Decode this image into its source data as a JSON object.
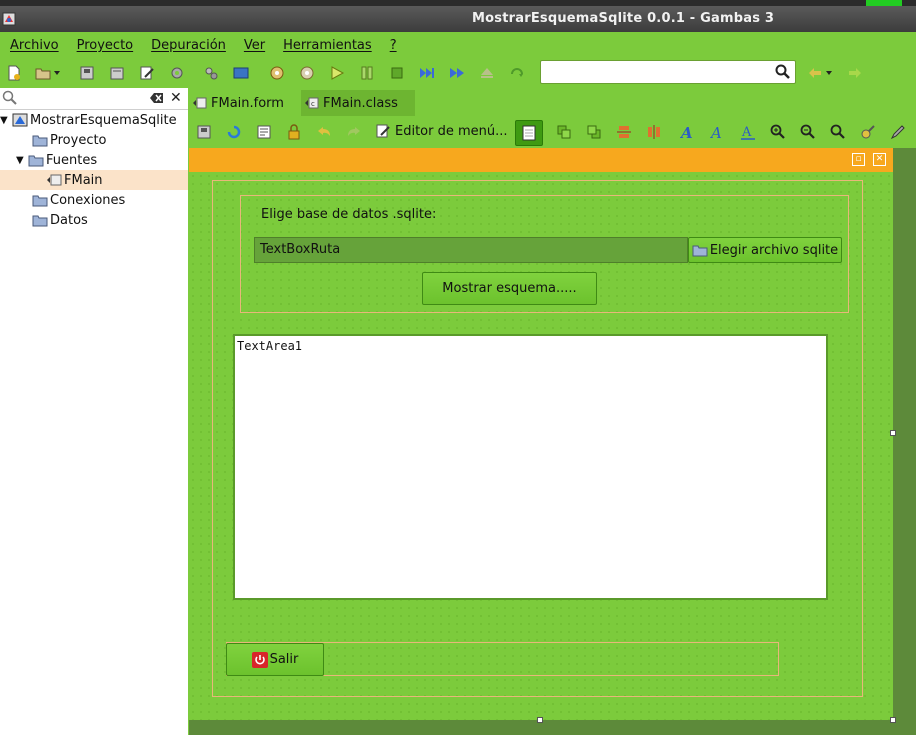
{
  "window": {
    "title": "MostrarEsquemaSqlite 0.0.1 - Gambas 3"
  },
  "menu": [
    "Archivo",
    "Proyecto",
    "Depuración",
    "Ver",
    "Herramientas",
    "?"
  ],
  "search": {
    "value": "",
    "placeholder": ""
  },
  "project_tree": {
    "root": "MostrarEsquemaSqlite",
    "items": [
      {
        "label": "Proyecto"
      },
      {
        "label": "Fuentes"
      },
      {
        "label": "FMain"
      },
      {
        "label": "Conexiones"
      },
      {
        "label": "Datos"
      }
    ]
  },
  "tabs": [
    {
      "label": "FMain.form"
    },
    {
      "label": "FMain.class"
    }
  ],
  "editor_toolbar": {
    "menu_editor": "Editor de menú..."
  },
  "form": {
    "label": "Elige base de datos .sqlite:",
    "textbox": "TextBoxRuta",
    "choose_button": "Elegir archivo sqlite",
    "show_button": "Mostrar esquema.....",
    "textarea": "TextArea1",
    "exit_button": "Salir"
  },
  "colors": {
    "accent": "#7ccb3c",
    "form_header": "#f7a81e",
    "selection": "#fbe3c9"
  }
}
